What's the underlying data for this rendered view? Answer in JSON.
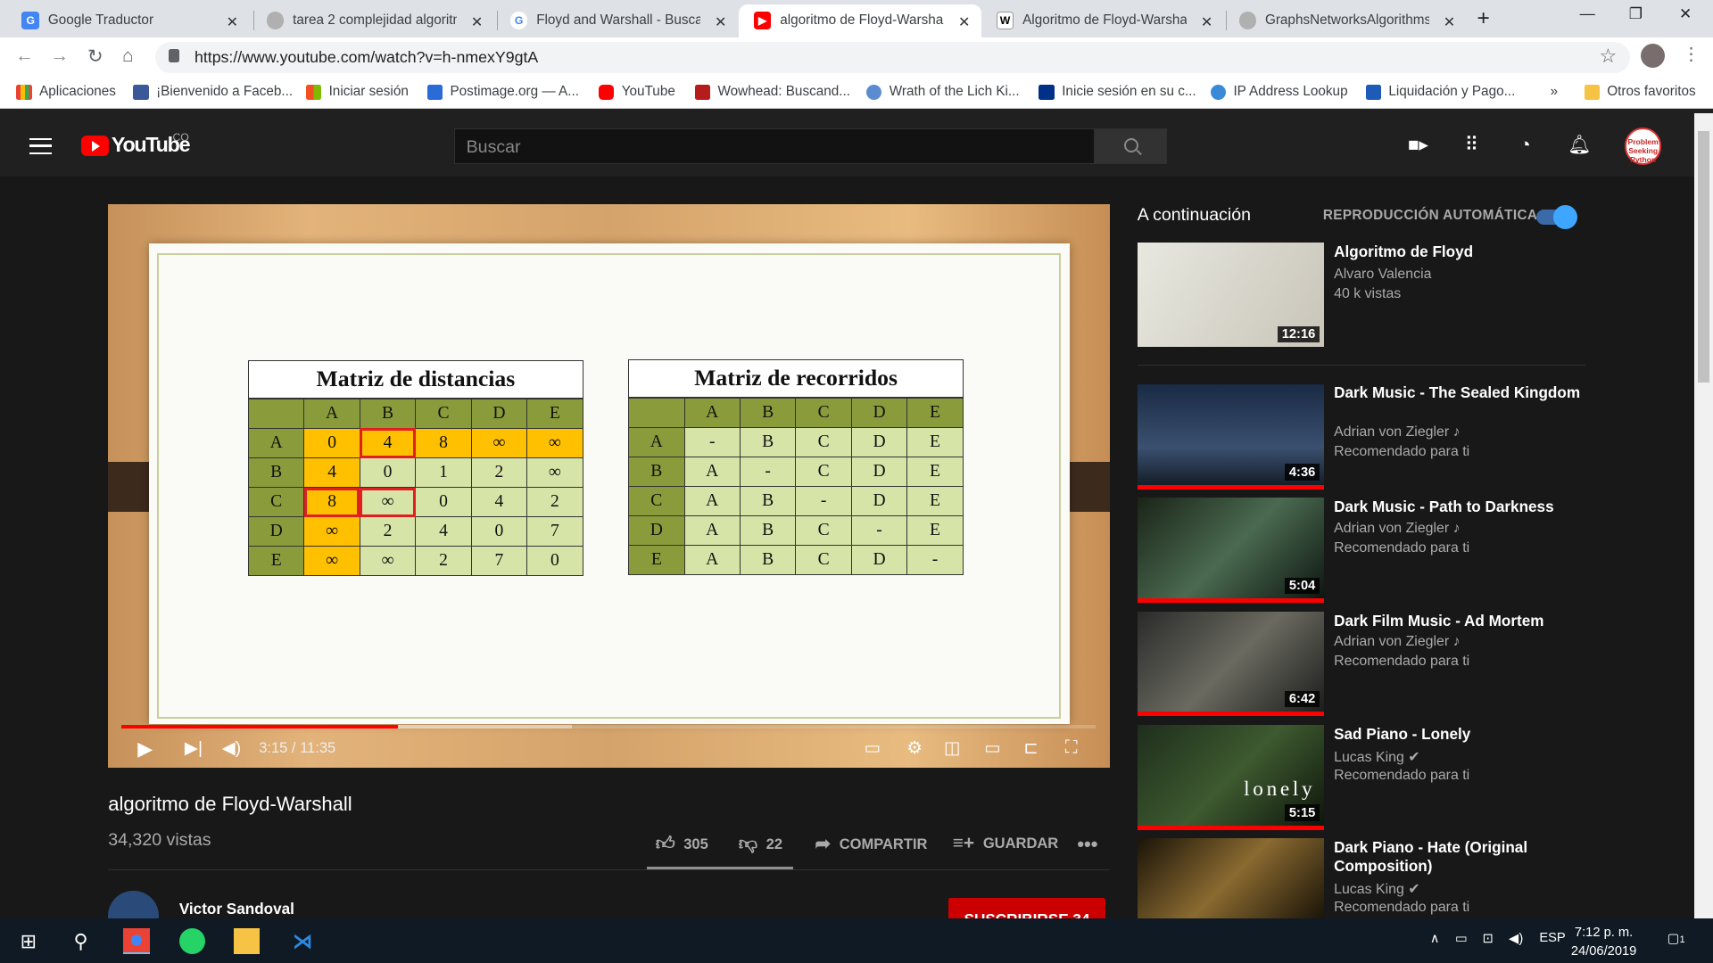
{
  "browser": {
    "tabs": [
      {
        "title": "Google Traductor",
        "active": false
      },
      {
        "title": "tarea 2 complejidad algoritm",
        "active": false
      },
      {
        "title": "Floyd and Warshall - Buscar c",
        "active": false
      },
      {
        "title": "algoritmo de Floyd-Warshall",
        "active": true
      },
      {
        "title": "Algoritmo de Floyd-Warshall",
        "active": false
      },
      {
        "title": "GraphsNetworksAlgorithms.p",
        "active": false
      }
    ],
    "url": "https://www.youtube.com/watch?v=h-nmexY9gtA",
    "bookmarks": [
      "Aplicaciones",
      "¡Bienvenido a Faceb...",
      "Iniciar sesión",
      "Postimage.org — A...",
      "YouTube",
      "Wowhead: Buscand...",
      "Wrath of the Lich Ki...",
      "Inicie sesión en su c...",
      "IP Address Lookup",
      "Liquidación y Pago...",
      "»",
      "Otros favoritos"
    ]
  },
  "youtube": {
    "logo": "YouTube",
    "region": "CO",
    "search_placeholder": "Buscar",
    "avatar_text": "Problem Seeking Python"
  },
  "video": {
    "title": "algoritmo de Floyd-Warshall",
    "views": "34,320 vistas",
    "time": "3:15 / 11:35",
    "progress_played": 0.284,
    "progress_buffered": 0.462,
    "likes": "305",
    "dislikes": "22",
    "share": "COMPARTIR",
    "save": "GUARDAR",
    "channel": "Victor Sandoval",
    "subscribe": "SUSCRIBIRSE 34",
    "slide": {
      "dist_title": "Matriz de distancias",
      "path_title": "Matriz de recorridos",
      "headers": [
        "A",
        "B",
        "C",
        "D",
        "E"
      ],
      "dist": [
        [
          "0",
          "4",
          "8",
          "∞",
          "∞"
        ],
        [
          "4",
          "0",
          "1",
          "2",
          "∞"
        ],
        [
          "8",
          "∞",
          "0",
          "4",
          "2"
        ],
        [
          "∞",
          "2",
          "4",
          "0",
          "7"
        ],
        [
          "∞",
          "∞",
          "2",
          "7",
          "0"
        ]
      ],
      "paths": [
        [
          "-",
          "B",
          "C",
          "D",
          "E"
        ],
        [
          "A",
          "-",
          "C",
          "D",
          "E"
        ],
        [
          "A",
          "B",
          "-",
          "D",
          "E"
        ],
        [
          "A",
          "B",
          "C",
          "-",
          "E"
        ],
        [
          "A",
          "B",
          "C",
          "D",
          "-"
        ]
      ]
    }
  },
  "sidebar": {
    "next_label": "A continuación",
    "autoplay_label": "REPRODUCCIÓN AUTOMÁTICA",
    "items": [
      {
        "title": "Algoritmo de Floyd",
        "channel": "Alvaro Valencia",
        "meta": "40 k vistas",
        "duration": "12:16"
      },
      {
        "title": "Dark Music - The Sealed Kingdom",
        "channel": "Adrian von Ziegler ♪",
        "meta": "Recomendado para ti",
        "duration": "4:36"
      },
      {
        "title": "Dark Music - Path to Darkness",
        "channel": "Adrian von Ziegler ♪",
        "meta": "Recomendado para ti",
        "duration": "5:04"
      },
      {
        "title": "Dark Film Music - Ad Mortem",
        "channel": "Adrian von Ziegler ♪",
        "meta": "Recomendado para ti",
        "duration": "6:42"
      },
      {
        "title": "Sad Piano - Lonely",
        "channel": "Lucas King ✔",
        "meta": "Recomendado para ti",
        "duration": "5:15",
        "thumb_text": "lonely"
      },
      {
        "title": "Dark Piano - Hate (Original Composition)",
        "channel": "Lucas King ✔",
        "meta": "Recomendado para ti",
        "duration": ""
      }
    ]
  },
  "taskbar": {
    "lang": "ESP",
    "time": "7:12 p. m.",
    "date": "24/06/2019",
    "notifications": "1"
  },
  "colors": {
    "accent": "#ff0000",
    "header": "#202020",
    "page": "#181818",
    "toggle": "#3ea6ff"
  }
}
